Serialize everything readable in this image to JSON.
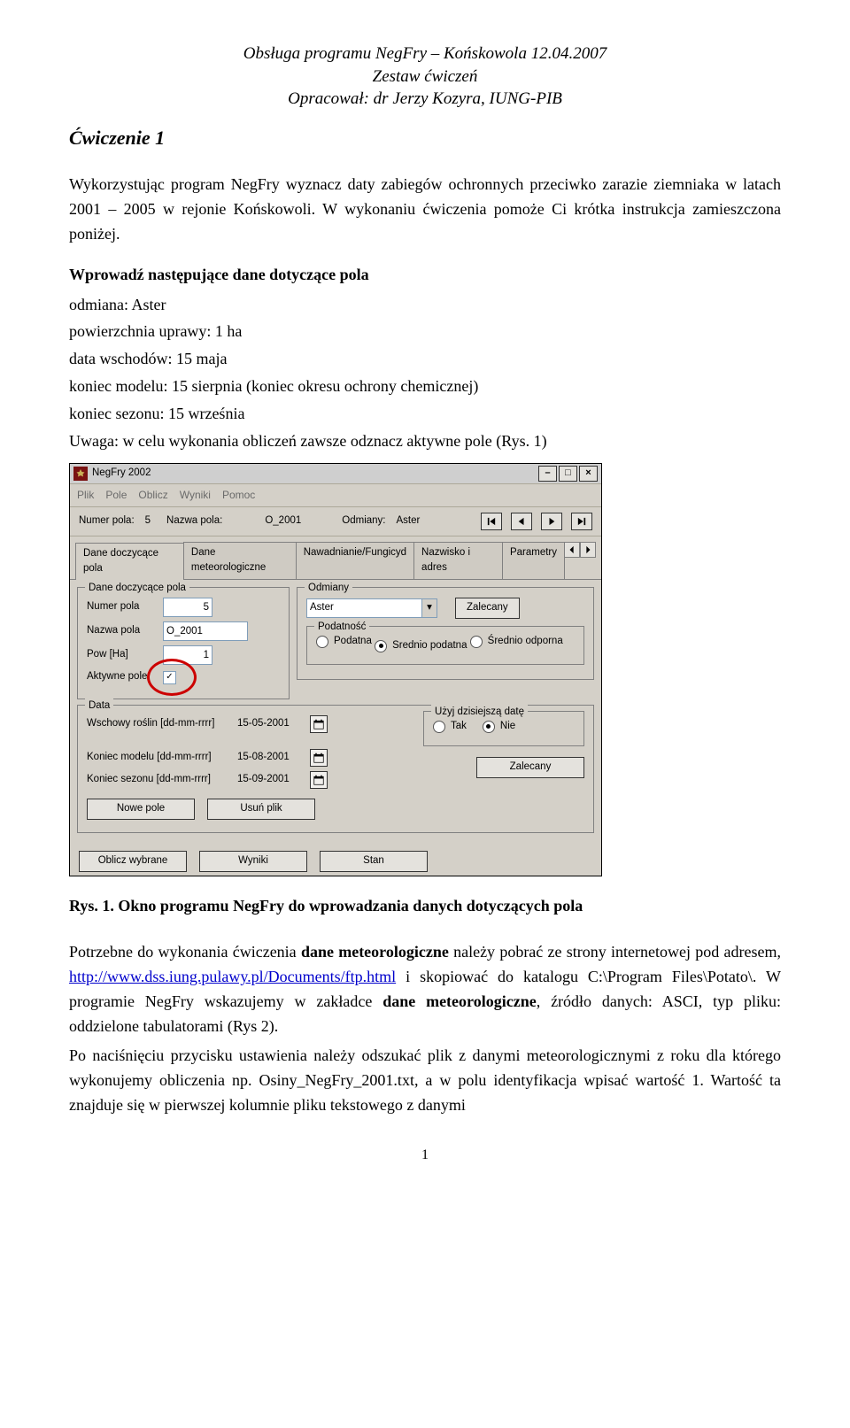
{
  "header": {
    "line1": "Obsługa programu NegFry – Końskowola 12.04.2007",
    "line2": "Zestaw ćwiczeń",
    "line3": "Opracował: dr Jerzy Kozyra, IUNG-PIB"
  },
  "ex_title": "Ćwiczenie 1",
  "lead1": "Wykorzystując program NegFry wyznacz daty zabiegów ochronnych przeciwko zarazie ziemniaka w latach 2001 – 2005 w rejonie Końskowoli. W wykonaniu ćwiczenia pomoże Ci krótka instrukcja zamieszczona poniżej.",
  "input_heading": "Wprowadź następujące dane dotyczące pola",
  "lines": {
    "odmiana": "odmiana: Aster",
    "pow": "powierzchnia uprawy: 1 ha",
    "wschody": "data wschodów: 15 maja",
    "koniec_modelu": "koniec modelu: 15 sierpnia (koniec okresu ochrony chemicznej)",
    "koniec_sezonu": "koniec sezonu: 15 września",
    "uwaga": "Uwaga: w celu wykonania obliczeń zawsze odznacz aktywne pole (Rys. 1)"
  },
  "caption": "Rys. 1. Okno programu NegFry do wprowadzania danych dotyczących pola",
  "para2_a": "Potrzebne do wykonania ćwiczenia ",
  "para2_b": "dane meteorologiczne",
  "para2_c": " należy pobrać ze strony internetowej pod adresem, ",
  "link_text": "http://www.dss.iung.pulawy.pl/Documents/ftp.html",
  "para2_d": " i skopiować do katalogu C:\\Program Files\\Potato\\. W programie NegFry wskazujemy w zakładce ",
  "para2_e": "dane meteorologiczne",
  "para2_f": ", źródło danych: ASCI, typ pliku: oddzielone tabulatorami (Rys 2).",
  "para3": "Po naciśnięciu przycisku ustawienia należy odszukać plik z danymi meteorologicznymi z roku dla którego wykonujemy obliczenia np. Osiny_NegFry_2001.txt, a w polu identyfikacja wpisać wartość 1. Wartość ta znajduje się w pierwszej kolumnie pliku tekstowego z danymi",
  "page_num": "1",
  "app": {
    "title": "NegFry 2002",
    "menu": [
      "Plik",
      "Pole",
      "Oblicz",
      "Wyniki",
      "Pomoc"
    ],
    "infobar": {
      "numer_pola_lbl": "Numer pola:",
      "numer_pola_val": "5",
      "nazwa_pola_lbl": "Nazwa pola:",
      "nazwa_pola_val": "O_2001",
      "odmiany_lbl": "Odmiany:",
      "odmiany_val": "Aster"
    },
    "tabs": [
      "Dane doczycące pola",
      "Dane meteorologiczne",
      "Nawadnianie/Fungicyd",
      "Nazwisko i adres",
      "Parametry"
    ],
    "grp_dane": "Dane doczycące pola",
    "numer_pola": "Numer pola",
    "numer_pola_v": "5",
    "nazwa_pola": "Nazwa pola",
    "nazwa_pola_v": "O_2001",
    "pow": "Pow [Ha]",
    "pow_v": "1",
    "aktywne": "Aktywne pole",
    "cbx_check": "✓",
    "grp_odmiany": "Odmiany",
    "odmiana_sel": "Aster",
    "zalecany": "Zalecany",
    "grp_podatnosc": "Podatność",
    "pod_1": "Podatna",
    "pod_2": "Srednio podatna",
    "pod_3": "Średnio odporna",
    "grp_data": "Data",
    "wschody_lbl": "Wschowy roślin [dd-mm-rrrr]",
    "wschody_v": "15-05-2001",
    "koniec_modelu_lbl": "Koniec modelu [dd-mm-rrrr]",
    "koniec_modelu_v": "15-08-2001",
    "koniec_sezonu_lbl": "Koniec sezonu [dd-mm-rrrr]",
    "koniec_sezonu_v": "15-09-2001",
    "grp_date_use": "Użyj dzisiejszą datę",
    "tak": "Tak",
    "nie": "Nie",
    "btn_nowe": "Nowe pole",
    "btn_usun": "Usuń plik",
    "btn_oblicz": "Oblicz wybrane",
    "btn_wyniki": "Wyniki",
    "btn_stan": "Stan"
  }
}
